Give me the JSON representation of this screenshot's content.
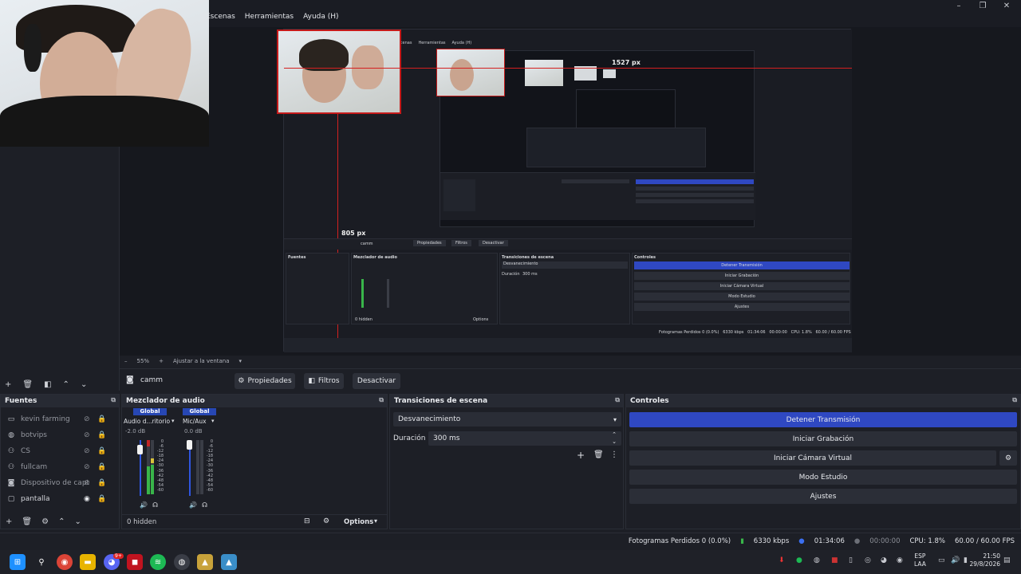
{
  "window": {
    "menu": [
      "Escenas",
      "Herramientas",
      "Ayuda (H)"
    ],
    "controls": [
      "–",
      "❐",
      "✕"
    ]
  },
  "preview": {
    "label_width": "1527 px",
    "label_height": "805 px",
    "nested_menu": [
      "Escenas",
      "Herramientas",
      "Ayuda (H)"
    ],
    "nested_toolbar": {
      "source": "camm",
      "props": "Propiedades",
      "filters": "Filtros",
      "deactivate": "Desactivar"
    },
    "nested_docks": {
      "sources": "Fuentes",
      "mixer": "Mezclador de audio",
      "transitions": "Transiciones de escena",
      "controls": "Controles",
      "transition_value": "Desvanecimiento",
      "duration_label": "Duración",
      "duration_value": "300 ms",
      "control_buttons": [
        "Detener Transmisión",
        "Iniciar Grabación",
        "Iniciar Cámara Virtual",
        "Modo Estudio",
        "Ajustes"
      ],
      "status": "Fotogramas Perdidos 0 (0.0%)   6330 kbps   01:34:06   00:00:00   CPU: 1.8%   60.00 / 60.00 FPS",
      "hidden": "0 hidden",
      "options": "Options"
    }
  },
  "zoombar": {
    "zoom": "55%",
    "fit": "Ajustar a la ventana"
  },
  "source_toolbar": {
    "source_name": "camm",
    "properties": "Propiedades",
    "filters": "Filtros",
    "deactivate": "Desactivar"
  },
  "sources": {
    "title": "Fuentes",
    "items": [
      {
        "label": "kevin farming",
        "icon": "window-icon",
        "visible": false
      },
      {
        "label": "botvips",
        "icon": "globe-icon",
        "visible": false
      },
      {
        "label": "CS",
        "icon": "gamepad-icon",
        "visible": false
      },
      {
        "label": "fullcam",
        "icon": "gamepad-icon",
        "visible": false
      },
      {
        "label": "Dispositivo de capt",
        "icon": "camera-icon",
        "visible": false
      },
      {
        "label": "pantalla",
        "icon": "monitor-icon",
        "visible": true
      }
    ]
  },
  "mixer": {
    "title": "Mezclador de audio",
    "channels": [
      {
        "header": "Global",
        "name": "Audio d...ritorio",
        "db": "-2.0 dB",
        "level": 0.62
      },
      {
        "header": "Global",
        "name": "Mic/Aux",
        "db": "0.0 dB",
        "level": 0.0
      }
    ],
    "scale": [
      "0",
      "-6",
      "-12",
      "-18",
      "-24",
      "-30",
      "-36",
      "-42",
      "-48",
      "-54",
      "-60"
    ],
    "hidden_count": "0 hidden",
    "options": "Options"
  },
  "transitions": {
    "title": "Transiciones de escena",
    "selected": "Desvanecimiento",
    "duration_label": "Duración",
    "duration_value": "300 ms"
  },
  "controls": {
    "title": "Controles",
    "buttons": [
      "Detener Transmisión",
      "Iniciar Grabación",
      "Iniciar Cámara Virtual",
      "Modo Estudio",
      "Ajustes"
    ]
  },
  "status": {
    "dropped": "Fotogramas Perdidos 0 (0.0%)",
    "bitrate": "6330 kbps",
    "stream_time": "01:34:06",
    "rec_time": "00:00:00",
    "cpu": "CPU: 1.8%",
    "fps": "60.00 / 60.00 FPS"
  },
  "taskbar": {
    "lang": "ESP",
    "region": "LAA",
    "time": "21:50",
    "date": "29/8/2026",
    "badge": "9+"
  },
  "colors": {
    "accent": "#2f48c2",
    "guide": "#d42020",
    "meter": "#39b54a"
  }
}
